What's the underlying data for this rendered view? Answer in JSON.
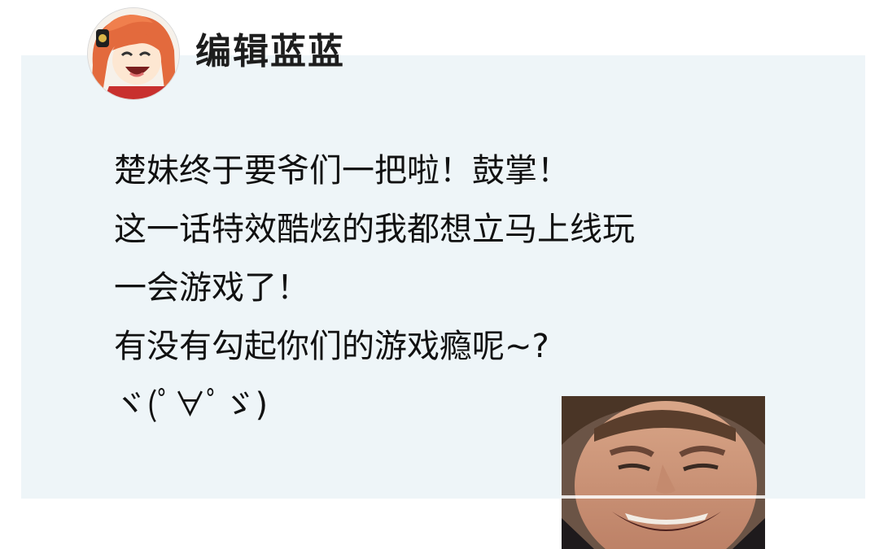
{
  "post": {
    "author": "编辑蓝蓝",
    "lines": [
      "楚妹终于要爷们一把啦！鼓掌！",
      "这一话特效酷炫的我都想立马上线玩",
      "一会游戏了！",
      "有没有勾起你们的游戏瘾呢~?",
      "ヾ(ﾟ∀ﾟゞ)"
    ]
  },
  "colors": {
    "card_background": "#eef5f8",
    "page_background": "#ffffff",
    "text": "#111111",
    "avatar_hair": "#e0673a"
  }
}
